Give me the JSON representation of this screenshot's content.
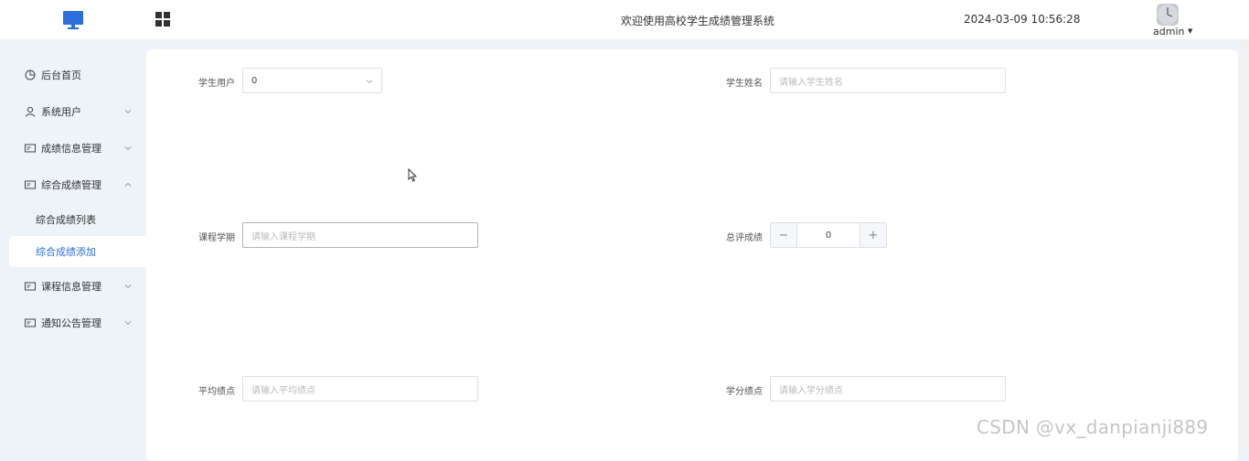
{
  "header": {
    "title": "欢迎使用高校学生成绩管理系统",
    "datetime": "2024-03-09 10:56:28",
    "user": "admin",
    "logo_icon": "monitor-icon",
    "menu_icon": "grid-icon",
    "accent_color": "#2d6fd8"
  },
  "sidebar": {
    "items": [
      {
        "label": "后台首页",
        "icon": "clock-icon"
      },
      {
        "label": "系统用户",
        "icon": "user-icon"
      },
      {
        "label": "成绩信息管理",
        "icon": "card-icon"
      },
      {
        "label": "综合成绩管理",
        "icon": "card-icon"
      },
      {
        "label": "课程信息管理",
        "icon": "card-icon"
      },
      {
        "label": "通知公告管理",
        "icon": "card-icon"
      }
    ],
    "sub_items": [
      {
        "label": "综合成绩列表"
      },
      {
        "label": "综合成绩添加",
        "active": true
      }
    ]
  },
  "form": {
    "student_user": {
      "label": "学生用户",
      "value": "0"
    },
    "student_name": {
      "label": "学生姓名",
      "placeholder": "请输入学生姓名"
    },
    "course_term": {
      "label": "课程学期",
      "placeholder": "请输入课程学期"
    },
    "total_score": {
      "label": "总评成绩",
      "value": "0",
      "minus": "−",
      "plus": "+"
    },
    "avg_gpa": {
      "label": "平均绩点",
      "placeholder": "请输入平均绩点"
    },
    "credit_gpa": {
      "label": "学分绩点",
      "placeholder": "请输入学分绩点"
    }
  },
  "watermark": "CSDN @vx_danpianji889"
}
